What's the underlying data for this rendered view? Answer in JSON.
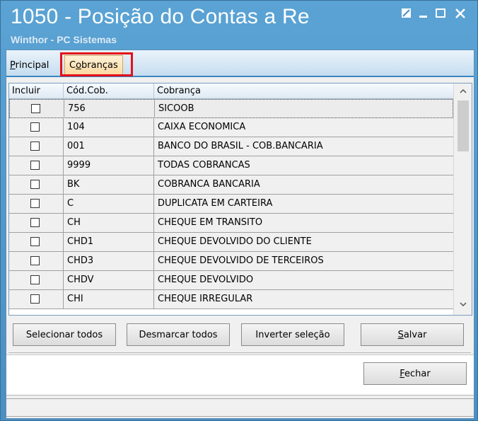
{
  "window": {
    "title": "1050 - Posição do Contas a Re",
    "subtitle": "Winthor - PC Sistemas"
  },
  "tabs": [
    {
      "label_prefix": "",
      "label_mnemonic": "P",
      "label_rest": "rincipal"
    },
    {
      "label_prefix": "C",
      "label_mnemonic": "o",
      "label_rest": "branças"
    }
  ],
  "grid": {
    "columns": [
      "Incluir",
      "Cód.Cob.",
      "Cobrança"
    ],
    "rows": [
      {
        "code": "756",
        "name": "SICOOB",
        "checked": false
      },
      {
        "code": "104",
        "name": "CAIXA ECONOMICA",
        "checked": false
      },
      {
        "code": "001",
        "name": "BANCO DO BRASIL - COB.BANCARIA",
        "checked": false
      },
      {
        "code": "9999",
        "name": "TODAS COBRANCAS",
        "checked": false
      },
      {
        "code": "BK",
        "name": "COBRANCA BANCARIA",
        "checked": false
      },
      {
        "code": "C",
        "name": "DUPLICATA EM CARTEIRA",
        "checked": false
      },
      {
        "code": "CH",
        "name": "CHEQUE EM TRANSITO",
        "checked": false
      },
      {
        "code": "CHD1",
        "name": "CHEQUE DEVOLVIDO DO CLIENTE",
        "checked": false
      },
      {
        "code": "CHD3",
        "name": "CHEQUE DEVOLVIDO DE TERCEIROS",
        "checked": false
      },
      {
        "code": "CHDV",
        "name": "CHEQUE DEVOLVIDO",
        "checked": false
      },
      {
        "code": "CHI",
        "name": "CHEQUE IRREGULAR",
        "checked": false
      }
    ]
  },
  "buttons": {
    "select_all": "Selecionar todos",
    "deselect_all": "Desmarcar todos",
    "invert": "Inverter seleção",
    "save_mnemonic": "S",
    "save_rest": "alvar",
    "close_mnemonic": "F",
    "close_rest": "echar"
  },
  "icons": {
    "restore": "restore-icon",
    "minimize": "minimize-icon",
    "maximize": "maximize-icon",
    "close": "close-icon"
  },
  "colors": {
    "title_bar": "#4a8fc2",
    "highlight": "#e4101a",
    "active_tab": "#fbd9a0"
  }
}
